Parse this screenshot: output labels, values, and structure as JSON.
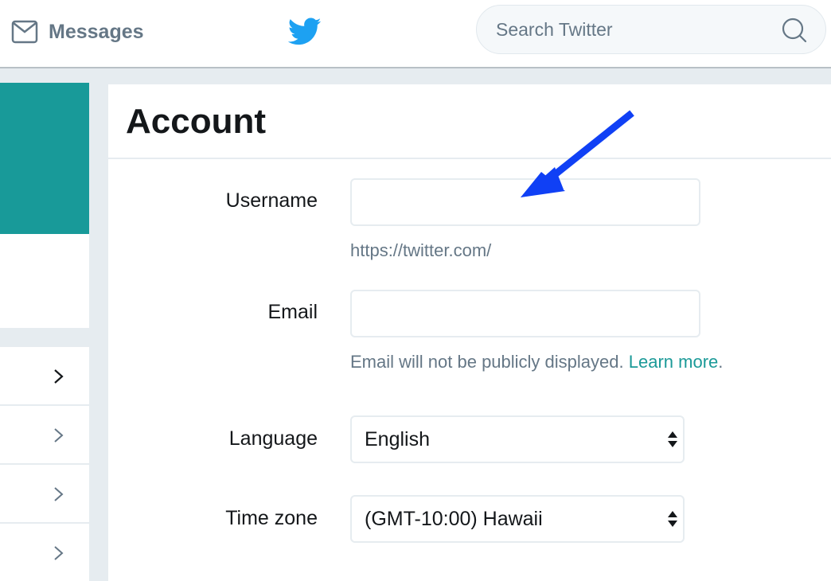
{
  "topbar": {
    "messages_label": "Messages",
    "messages_icon": "envelope-icon",
    "logo_icon": "twitter-bird-icon",
    "search": {
      "placeholder": "Search Twitter",
      "value": "",
      "icon": "search-icon"
    }
  },
  "sidebar": {
    "banner_color": "#189a99",
    "menu_items": [
      {
        "icon": "chevron-right-icon",
        "active": true
      },
      {
        "icon": "chevron-right-icon",
        "active": false
      },
      {
        "icon": "chevron-right-icon",
        "active": false
      },
      {
        "icon": "chevron-right-icon",
        "active": false
      }
    ]
  },
  "main": {
    "title": "Account",
    "username": {
      "label": "Username",
      "value": "",
      "help": "https://twitter.com/"
    },
    "email": {
      "label": "Email",
      "value": "",
      "help": "Email will not be publicly displayed.",
      "help_link": "Learn more",
      "help_suffix": "."
    },
    "language": {
      "label": "Language",
      "selected": "English"
    },
    "timezone": {
      "label": "Time zone",
      "selected": "(GMT-10:00) Hawaii"
    }
  },
  "annotation": {
    "type": "arrow",
    "color": "#1040f5",
    "points_to": "username-input"
  },
  "colors": {
    "brand": "#1da1f2",
    "accent": "#1b9a98",
    "text": "#14171a",
    "muted": "#657786"
  }
}
